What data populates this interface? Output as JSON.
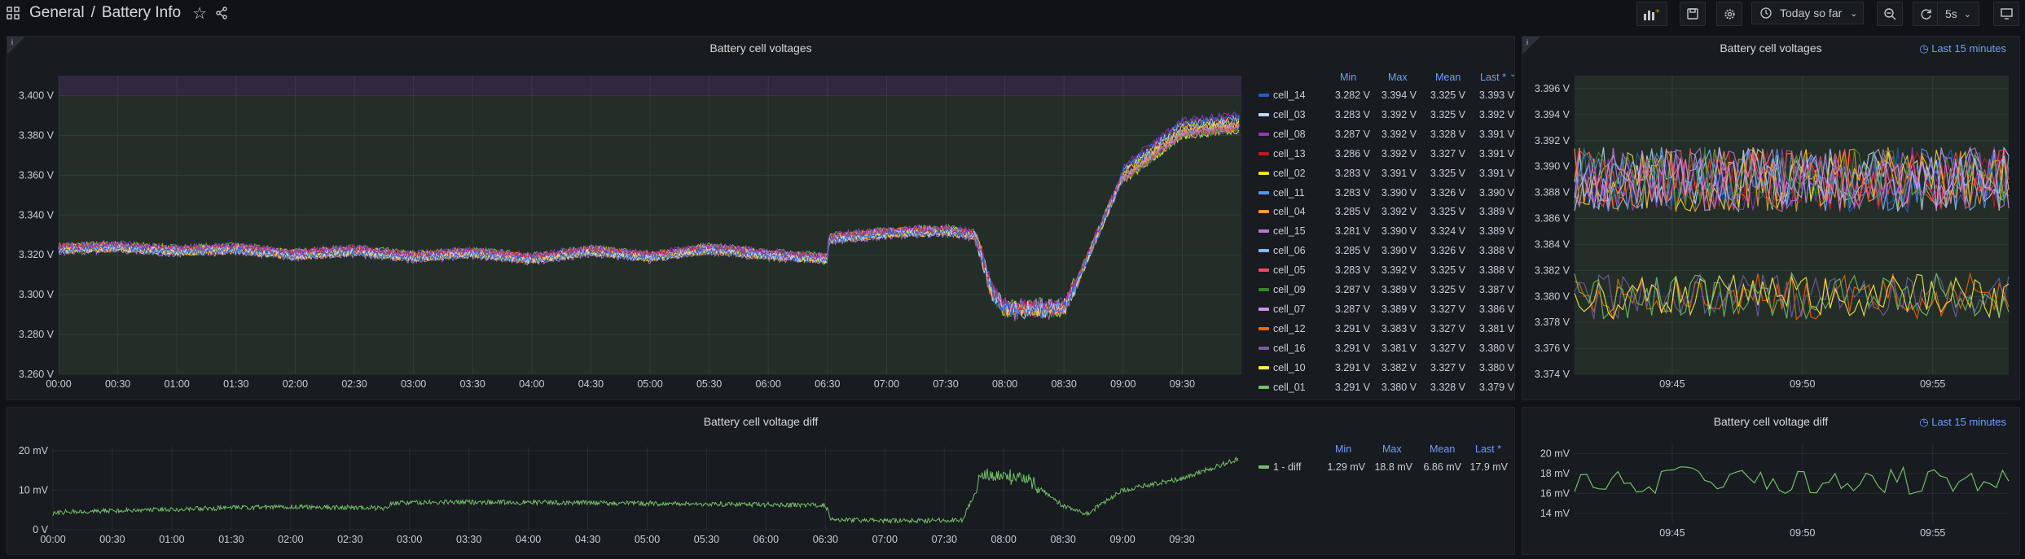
{
  "nav": {
    "folder": "General",
    "separator": "/",
    "dashboard": "Battery Info",
    "time_range": "Today so far",
    "refresh": "5s"
  },
  "panels": {
    "main": {
      "title": "Battery cell voltages",
      "legend_headers": {
        "min": "Min",
        "max": "Max",
        "mean": "Mean",
        "last": "Last *"
      },
      "legend": [
        {
          "name": "cell_14",
          "color": "#1f60c4",
          "min": "3.282 V",
          "max": "3.394 V",
          "mean": "3.325 V",
          "last": "3.393 V"
        },
        {
          "name": "cell_03",
          "color": "#c0d8ff",
          "min": "3.283 V",
          "max": "3.392 V",
          "mean": "3.325 V",
          "last": "3.392 V"
        },
        {
          "name": "cell_08",
          "color": "#8f3bb8",
          "min": "3.287 V",
          "max": "3.392 V",
          "mean": "3.328 V",
          "last": "3.391 V"
        },
        {
          "name": "cell_13",
          "color": "#c4162a",
          "min": "3.286 V",
          "max": "3.392 V",
          "mean": "3.327 V",
          "last": "3.391 V"
        },
        {
          "name": "cell_02",
          "color": "#fade2a",
          "min": "3.283 V",
          "max": "3.391 V",
          "mean": "3.325 V",
          "last": "3.391 V"
        },
        {
          "name": "cell_11",
          "color": "#5794f2",
          "min": "3.283 V",
          "max": "3.390 V",
          "mean": "3.326 V",
          "last": "3.390 V"
        },
        {
          "name": "cell_04",
          "color": "#ff9830",
          "min": "3.285 V",
          "max": "3.392 V",
          "mean": "3.325 V",
          "last": "3.389 V"
        },
        {
          "name": "cell_15",
          "color": "#b877d9",
          "min": "3.281 V",
          "max": "3.390 V",
          "mean": "3.324 V",
          "last": "3.389 V"
        },
        {
          "name": "cell_06",
          "color": "#8ab8ff",
          "min": "3.285 V",
          "max": "3.390 V",
          "mean": "3.326 V",
          "last": "3.388 V"
        },
        {
          "name": "cell_05",
          "color": "#f2495c",
          "min": "3.283 V",
          "max": "3.392 V",
          "mean": "3.325 V",
          "last": "3.388 V"
        },
        {
          "name": "cell_09",
          "color": "#37872d",
          "min": "3.287 V",
          "max": "3.389 V",
          "mean": "3.325 V",
          "last": "3.387 V"
        },
        {
          "name": "cell_07",
          "color": "#ca95e5",
          "min": "3.287 V",
          "max": "3.389 V",
          "mean": "3.327 V",
          "last": "3.386 V"
        },
        {
          "name": "cell_12",
          "color": "#fa6400",
          "min": "3.291 V",
          "max": "3.383 V",
          "mean": "3.327 V",
          "last": "3.381 V"
        },
        {
          "name": "cell_16",
          "color": "#7c5aa6",
          "min": "3.291 V",
          "max": "3.381 V",
          "mean": "3.327 V",
          "last": "3.380 V"
        },
        {
          "name": "cell_10",
          "color": "#ffee52",
          "min": "3.291 V",
          "max": "3.382 V",
          "mean": "3.327 V",
          "last": "3.380 V"
        },
        {
          "name": "cell_01",
          "color": "#73bf69",
          "min": "3.291 V",
          "max": "3.380 V",
          "mean": "3.328 V",
          "last": "3.379 V"
        }
      ]
    },
    "main_right": {
      "title": "Battery cell voltages",
      "time_info": "Last 15 minutes"
    },
    "diff": {
      "title": "Battery cell voltage diff",
      "legend_headers": {
        "min": "Min",
        "max": "Max",
        "mean": "Mean",
        "last": "Last *"
      },
      "legend": [
        {
          "name": "1 - diff",
          "color": "#73bf69",
          "min": "1.29 mV",
          "max": "18.8 mV",
          "mean": "6.86 mV",
          "last": "17.9 mV"
        }
      ]
    },
    "diff_right": {
      "title": "Battery cell voltage diff",
      "time_info": "Last 15 minutes"
    }
  },
  "chart_data": [
    {
      "type": "line",
      "title": "Battery cell voltages",
      "unit": "V",
      "x_ticks": [
        "00:00",
        "00:30",
        "01:00",
        "01:30",
        "02:00",
        "02:30",
        "03:00",
        "03:30",
        "04:00",
        "04:30",
        "05:00",
        "05:30",
        "06:00",
        "06:30",
        "07:00",
        "07:30",
        "08:00",
        "08:30",
        "09:00",
        "09:30"
      ],
      "y_ticks": [
        "3.260 V",
        "3.280 V",
        "3.300 V",
        "3.320 V",
        "3.340 V",
        "3.360 V",
        "3.380 V",
        "3.400 V"
      ],
      "ylim": [
        3.26,
        3.41
      ],
      "x_hours": [
        0,
        0.5,
        1,
        1.5,
        2,
        2.5,
        3,
        3.5,
        4,
        4.5,
        5,
        5.5,
        6,
        6.5,
        6.51,
        7,
        7.5,
        7.75,
        7.9,
        8,
        8.5,
        8.6,
        9,
        9.5,
        9.98
      ],
      "y": [
        3.323,
        3.324,
        3.322,
        3.323,
        3.32,
        3.322,
        3.319,
        3.321,
        3.318,
        3.322,
        3.319,
        3.323,
        3.32,
        3.318,
        3.328,
        3.331,
        3.332,
        3.33,
        3.3,
        3.293,
        3.293,
        3.305,
        3.36,
        3.383,
        3.386
      ],
      "threshold": 3.4
    },
    {
      "type": "line",
      "title": "Battery cell voltages",
      "unit": "V",
      "x_ticks": [
        "09:45",
        "09:50",
        "09:55"
      ],
      "y_ticks": [
        "3.374 V",
        "3.376 V",
        "3.378 V",
        "3.380 V",
        "3.382 V",
        "3.384 V",
        "3.386 V",
        "3.388 V",
        "3.390 V",
        "3.392 V",
        "3.394 V",
        "3.396 V"
      ],
      "ylim": [
        3.374,
        3.397
      ],
      "bands": [
        {
          "center": 3.389,
          "spread": 0.0025
        },
        {
          "center": 3.38,
          "spread": 0.0018
        }
      ]
    },
    {
      "type": "line",
      "title": "Battery cell voltage diff",
      "unit": "mV",
      "x_ticks": [
        "00:00",
        "00:30",
        "01:00",
        "01:30",
        "02:00",
        "02:30",
        "03:00",
        "03:30",
        "04:00",
        "04:30",
        "05:00",
        "05:30",
        "06:00",
        "06:30",
        "07:00",
        "07:30",
        "08:00",
        "08:30",
        "09:00",
        "09:30"
      ],
      "y_ticks": [
        "0 V",
        "10 mV",
        "20 mV"
      ],
      "ylim": [
        0,
        21
      ],
      "x_hours": [
        0,
        0.1,
        1.0,
        2.0,
        2.8,
        2.85,
        3.5,
        4.5,
        5.5,
        6.5,
        6.55,
        7.0,
        7.65,
        7.75,
        7.8,
        8.2,
        8.5,
        8.7,
        9.0,
        9.5,
        9.97
      ],
      "y": [
        4,
        4.5,
        5.2,
        5.8,
        5.5,
        6.8,
        7.0,
        6.8,
        6.5,
        6.2,
        2.6,
        2.2,
        2.5,
        8.5,
        14,
        13,
        6,
        4,
        10,
        13,
        17.9
      ]
    },
    {
      "type": "line",
      "title": "Battery cell voltage diff",
      "unit": "mV",
      "x_ticks": [
        "09:45",
        "09:50",
        "09:55"
      ],
      "y_ticks": [
        "14 mV",
        "16 mV",
        "18 mV",
        "20 mV"
      ],
      "ylim": [
        13,
        21
      ],
      "center": 17.3,
      "spread": 1.4
    }
  ]
}
